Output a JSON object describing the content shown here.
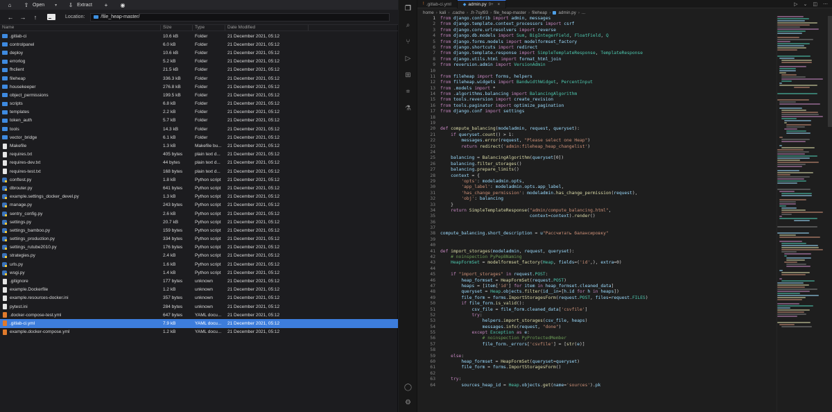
{
  "file_manager": {
    "toolbar": {
      "home_icon": "home-icon",
      "upload_icon": "upload-icon",
      "open_label": "Open",
      "extract_label": "Extract",
      "archive_icon": "archive-icon"
    },
    "location": {
      "label": "Location:",
      "path": "/file_heap-master/"
    },
    "columns": {
      "name": "Name",
      "size": "Size",
      "type": "Type",
      "date": "Date Modified"
    },
    "files": [
      {
        "name": ".gitlab-ci",
        "size": "10.6 kB",
        "type": "Folder",
        "date": "21 December 2021, 05:12",
        "icon": "folder-icon"
      },
      {
        "name": "controlpanel",
        "size": "6.0 kB",
        "type": "Folder",
        "date": "21 December 2021, 05:12",
        "icon": "folder-icon"
      },
      {
        "name": "deploy",
        "size": "10.6 kB",
        "type": "Folder",
        "date": "21 December 2021, 05:12",
        "icon": "folder-icon"
      },
      {
        "name": "errorlog",
        "size": "5.2 kB",
        "type": "Folder",
        "date": "21 December 2021, 05:12",
        "icon": "folder-icon"
      },
      {
        "name": "fhclient",
        "size": "21.5 kB",
        "type": "Folder",
        "date": "21 December 2021, 05:12",
        "icon": "folder-icon"
      },
      {
        "name": "fileheap",
        "size": "336.3 kB",
        "type": "Folder",
        "date": "21 December 2021, 05:12",
        "icon": "folder-icon"
      },
      {
        "name": "housekeeper",
        "size": "276.8 kB",
        "type": "Folder",
        "date": "21 December 2021, 05:12",
        "icon": "folder-icon"
      },
      {
        "name": "object_permissions",
        "size": "199.5 kB",
        "type": "Folder",
        "date": "21 December 2021, 05:12",
        "icon": "folder-icon"
      },
      {
        "name": "scripts",
        "size": "6.8 kB",
        "type": "Folder",
        "date": "21 December 2021, 05:12",
        "icon": "folder-icon"
      },
      {
        "name": "templates",
        "size": "2.2 kB",
        "type": "Folder",
        "date": "21 December 2021, 05:12",
        "icon": "folder-icon"
      },
      {
        "name": "token_auth",
        "size": "5.7 kB",
        "type": "Folder",
        "date": "21 December 2021, 05:12",
        "icon": "folder-icon"
      },
      {
        "name": "tools",
        "size": "14.3 kB",
        "type": "Folder",
        "date": "21 December 2021, 05:12",
        "icon": "folder-icon"
      },
      {
        "name": "vector_bridge",
        "size": "6.1 kB",
        "type": "Folder",
        "date": "21 December 2021, 05:12",
        "icon": "folder-icon"
      },
      {
        "name": "Makefile",
        "size": "1.3 kB",
        "type": "Makefile bu...",
        "date": "21 December 2021, 05:12",
        "icon": "document-icon"
      },
      {
        "name": "requires.txt",
        "size": "405 bytes",
        "type": "plain text d...",
        "date": "21 December 2021, 05:12",
        "icon": "document-icon"
      },
      {
        "name": "requires-dev.txt",
        "size": "44 bytes",
        "type": "plain text d...",
        "date": "21 December 2021, 05:12",
        "icon": "document-icon"
      },
      {
        "name": "requires-test.txt",
        "size": "168 bytes",
        "type": "plain text d...",
        "date": "21 December 2021, 05:12",
        "icon": "document-icon"
      },
      {
        "name": "conftest.py",
        "size": "1.8 kB",
        "type": "Python script",
        "date": "21 December 2021, 05:12",
        "icon": "python-icon"
      },
      {
        "name": "dbrouter.py",
        "size": "641 bytes",
        "type": "Python script",
        "date": "21 December 2021, 05:12",
        "icon": "python-icon"
      },
      {
        "name": "example.settings_docker_devel.py",
        "size": "1.3 kB",
        "type": "Python script",
        "date": "21 December 2021, 05:12",
        "icon": "python-icon"
      },
      {
        "name": "manage.py",
        "size": "243 bytes",
        "type": "Python script",
        "date": "21 December 2021, 05:12",
        "icon": "python-icon"
      },
      {
        "name": "sentry_config.py",
        "size": "2.6 kB",
        "type": "Python script",
        "date": "21 December 2021, 05:12",
        "icon": "python-icon"
      },
      {
        "name": "settings.py",
        "size": "20.7 kB",
        "type": "Python script",
        "date": "21 December 2021, 05:12",
        "icon": "python-icon"
      },
      {
        "name": "settings_bamboo.py",
        "size": "159 bytes",
        "type": "Python script",
        "date": "21 December 2021, 05:12",
        "icon": "python-icon"
      },
      {
        "name": "settings_production.py",
        "size": "334 bytes",
        "type": "Python script",
        "date": "21 December 2021, 05:12",
        "icon": "python-icon"
      },
      {
        "name": "settings_rutube2010.py",
        "size": "176 bytes",
        "type": "Python script",
        "date": "21 December 2021, 05:12",
        "icon": "python-icon"
      },
      {
        "name": "strategies.py",
        "size": "2.4 kB",
        "type": "Python script",
        "date": "21 December 2021, 05:12",
        "icon": "python-icon"
      },
      {
        "name": "urls.py",
        "size": "1.6 kB",
        "type": "Python script",
        "date": "21 December 2021, 05:12",
        "icon": "python-icon"
      },
      {
        "name": "wsgi.py",
        "size": "1.4 kB",
        "type": "Python script",
        "date": "21 December 2021, 05:12",
        "icon": "python-icon"
      },
      {
        "name": ".gitignore",
        "size": "177 bytes",
        "type": "unknown",
        "date": "21 December 2021, 05:12",
        "icon": "document-icon"
      },
      {
        "name": "example.Dockerfile",
        "size": "1.2 kB",
        "type": "unknown",
        "date": "21 December 2021, 05:12",
        "icon": "document-icon"
      },
      {
        "name": "example.resources-docker.ini",
        "size": "357 bytes",
        "type": "unknown",
        "date": "21 December 2021, 05:12",
        "icon": "document-icon"
      },
      {
        "name": "pytest.ini",
        "size": "284 bytes",
        "type": "unknown",
        "date": "21 December 2021, 05:12",
        "icon": "document-icon"
      },
      {
        "name": ".docker-compose-test.yml",
        "size": "647 bytes",
        "type": "YAML docu...",
        "date": "21 December 2021, 05:12",
        "icon": "yaml-icon"
      },
      {
        "name": ".gitlab-ci.yml",
        "size": "7.9 kB",
        "type": "YAML docu...",
        "date": "21 December 2021, 05:12",
        "icon": "yaml-icon",
        "selected": true
      },
      {
        "name": "example.docker-compose.yml",
        "size": "1.2 kB",
        "type": "YAML docu...",
        "date": "21 December 2021, 05:12",
        "icon": "yaml-icon"
      }
    ]
  },
  "editor": {
    "activity_icons": [
      "files-icon",
      "search-icon",
      "source-control-icon",
      "run-debug-icon",
      "extensions-icon",
      "remote-icon",
      "testing-icon",
      "account-icon",
      "settings-gear-icon"
    ],
    "tabs": [
      {
        "label": ".gitlab-ci.yml",
        "icon": "yaml-icon",
        "active": false,
        "badge": ""
      },
      {
        "label": "admin.py",
        "icon": "python-icon",
        "active": true,
        "badge": "9+"
      }
    ],
    "breadcrumb": [
      "home",
      "kali",
      ".cache",
      ".fr-7syl93",
      "file_heap-master",
      "fileheap",
      "admin.py",
      "..."
    ],
    "colors": {
      "keyword": "#c586c0",
      "function": "#dcdcaa",
      "string": "#ce9178",
      "comment": "#6a9955",
      "module": "#4ec9b0",
      "variable": "#9cdcfe",
      "accent": "#3d7ddc"
    },
    "code_lines": [
      "from django.contrib import admin, messages",
      "from django.template.context_processors import csrf",
      "from django.core.urlresolvers import reverse",
      "from django.db.models import Sum, BigIntegerField, FloatField, Q",
      "from django.forms.models import modelformset_factory",
      "from django.shortcuts import redirect",
      "from django.template.response import SimpleTemplateResponse, TemplateResponse",
      "from django.utils.html import format_html_join",
      "from reversion.admin import VersionAdmin",
      "",
      "from fileheap import forms, helpers",
      "from fileheap.widgets import BandwidthWidget, PercentInput",
      "from .models import *",
      "from .algorithms.balancing import BalancingAlgorithm",
      "from tools.reversion import create_revision",
      "from tools.paginator import optimize_pagination",
      "from django.conf import settings",
      "",
      "",
      "def compute_balancing(modeladmin, request, queryset):",
      "    if queryset.count() > 1:",
      "        messages.error(request, \"Please select one Heap\")",
      "        return redirect('admin:fileheap_heap_changelist')",
      "",
      "    balancing = BalancingAlgorithm(queryset[0])",
      "    balancing.filter_storages()",
      "    balancing.prepare_limits()",
      "    context = {",
      "        'opts': modeladmin.opts,",
      "        'app_label': modeladmin.opts.app_label,",
      "        'has_change_permission': modeladmin.has_change_permission(request),",
      "        'obj': balancing",
      "    }",
      "    return SimpleTemplateResponse(\"admin/compute_balancing.html\",",
      "                                  context=context).render()",
      "",
      "",
      "compute_balancing.short_description = u\"Рассчитать балансировку\"",
      "",
      "",
      "def import_storages(modeladmin, request, queryset):",
      "    # noinspection PyPep8Naming",
      "    HeapFormSet = modelformset_factory(Heap, fields=('id',), extra=0)",
      "",
      "    if \"import_storages\" in request.POST:",
      "        heap_formset = HeapFormSet(request.POST)",
      "        heaps = [item['id'] for item in heap_formset.cleaned_data]",
      "        queryset = Heap.objects.filter(id__in=[h.id for h in heaps])",
      "        file_form = forms.ImportStoragesForm(request.POST, files=request.FILES)",
      "        if file_form.is_valid():",
      "            csv_file = file_form.cleaned_data['csvfile']",
      "            try:",
      "                helpers.import_storages(csv_file, heaps)",
      "                messages.info(request, \"done\")",
      "            except Exception as e:",
      "                # noinspection PyProtectedMember",
      "                file_form._errors['csvfile'] = [str(e)]",
      "",
      "    else:",
      "        heap_formset = HeapFormSet(queryset=queryset)",
      "        file_form = forms.ImportStoragesForm()",
      "",
      "    try:",
      "        sources_heap_id = Heap.objects.get(name='sources').pk"
    ]
  }
}
